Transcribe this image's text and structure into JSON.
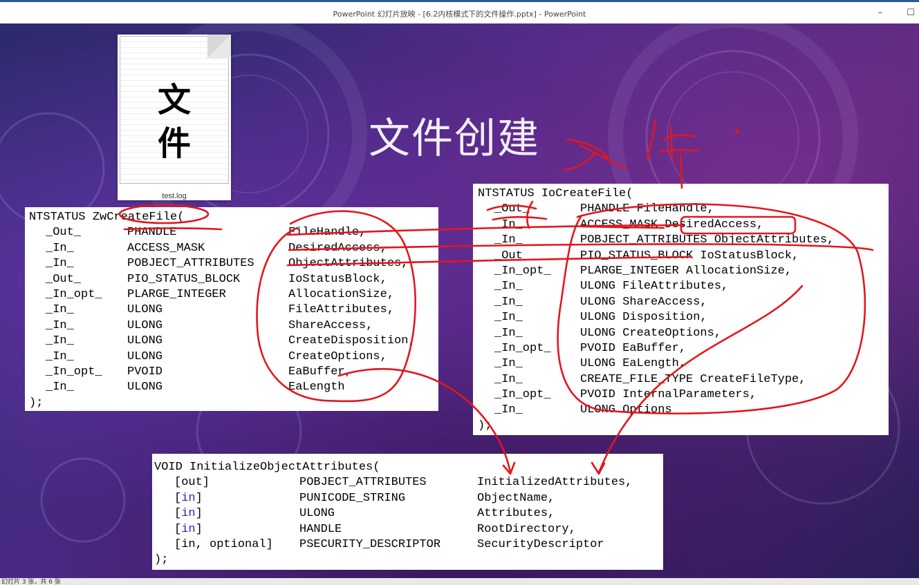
{
  "window": {
    "title": "PowerPoint 幻灯片放映 - [6.2内核模式下的文件操作.pptx] - PowerPoint",
    "minimize_glyph": "–",
    "maximize_glyph": "☐"
  },
  "slide": {
    "title": "文件创建",
    "file_icon": {
      "glyph_top": "文",
      "glyph_bottom": "件",
      "filename": "test.log"
    },
    "handwriting": "文件",
    "zw_create_file": {
      "header": "NTSTATUS ZwCreateFile(",
      "rows": [
        {
          "ann": "_Out_",
          "type": "PHANDLE",
          "name": "FileHandle,"
        },
        {
          "ann": "_In_",
          "type": "ACCESS_MASK",
          "name": "DesiredAccess,"
        },
        {
          "ann": "_In_",
          "type": "POBJECT_ATTRIBUTES",
          "name": "ObjectAttributes,"
        },
        {
          "ann": "_Out_",
          "type": "PIO_STATUS_BLOCK",
          "name": "IoStatusBlock,"
        },
        {
          "ann": "_In_opt_",
          "type": "PLARGE_INTEGER",
          "name": "AllocationSize,"
        },
        {
          "ann": "_In_",
          "type": "ULONG",
          "name": "FileAttributes,"
        },
        {
          "ann": "_In_",
          "type": "ULONG",
          "name": "ShareAccess,"
        },
        {
          "ann": "_In_",
          "type": "ULONG",
          "name": "CreateDisposition,"
        },
        {
          "ann": "_In_",
          "type": "ULONG",
          "name": "CreateOptions,"
        },
        {
          "ann": "_In_opt_",
          "type": "PVOID",
          "name": "EaBuffer,"
        },
        {
          "ann": "_In_",
          "type": "ULONG",
          "name": "EaLength"
        }
      ],
      "footer": ");"
    },
    "io_create_file": {
      "header": "NTSTATUS IoCreateFile(",
      "rows": [
        {
          "ann": "_Out_",
          "decl": "PHANDLE FileHandle,"
        },
        {
          "ann": "_In_",
          "decl": "ACCESS_MASK DesiredAccess,"
        },
        {
          "ann": "_In_",
          "decl": "POBJECT_ATTRIBUTES ObjectAttributes,"
        },
        {
          "ann": "_Out_",
          "decl": "PIO_STATUS_BLOCK IoStatusBlock,"
        },
        {
          "ann": "_In_opt_",
          "decl": "PLARGE_INTEGER AllocationSize,"
        },
        {
          "ann": "_In_",
          "decl": "ULONG FileAttributes,"
        },
        {
          "ann": "_In_",
          "decl": "ULONG ShareAccess,"
        },
        {
          "ann": "_In_",
          "decl": "ULONG Disposition,"
        },
        {
          "ann": "_In_",
          "decl": "ULONG CreateOptions,"
        },
        {
          "ann": "_In_opt_",
          "decl": "PVOID EaBuffer,"
        },
        {
          "ann": "_In_",
          "decl": "ULONG EaLength,"
        },
        {
          "ann": "_In_",
          "decl": "CREATE_FILE_TYPE CreateFileType,"
        },
        {
          "ann": "_In_opt_",
          "decl": "PVOID InternalParameters,"
        },
        {
          "ann": "_In_",
          "decl": "ULONG Options"
        }
      ],
      "footer": ");"
    },
    "init_object_attributes": {
      "header": "VOID InitializeObjectAttributes(",
      "rows": [
        {
          "ann_pre": "[",
          "ann_kw": "",
          "ann_text": "[out]",
          "type": "POBJECT_ATTRIBUTES",
          "name": "InitializedAttributes,"
        },
        {
          "ann_text": "[in]",
          "type": "PUNICODE_STRING",
          "name": "ObjectName,"
        },
        {
          "ann_text": "[in]",
          "type": "ULONG",
          "name": "Attributes,"
        },
        {
          "ann_text": "[in]",
          "type": "HANDLE",
          "name": "RootDirectory,"
        },
        {
          "ann_text": "[in, optional]",
          "type": "PSECURITY_DESCRIPTOR",
          "name": "SecurityDescriptor"
        }
      ],
      "footer": ");"
    }
  },
  "status_bar": {
    "text": "幻灯片 3 张，共 6 张"
  },
  "colors": {
    "ink": "#e3161d",
    "keyword": "#1b27c9"
  }
}
